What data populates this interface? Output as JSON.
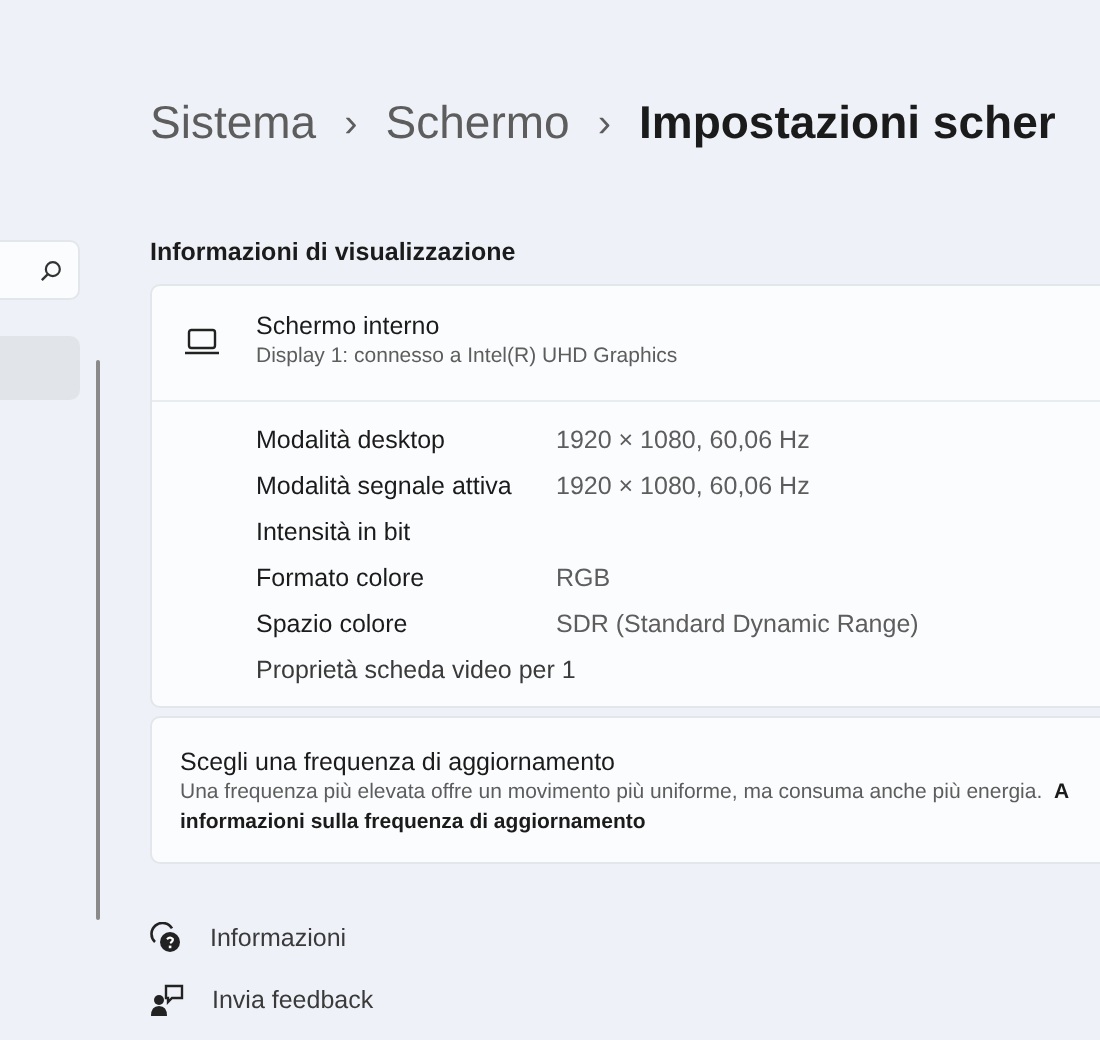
{
  "breadcrumb": [
    {
      "label": "Sistema",
      "current": false
    },
    {
      "label": "Schermo",
      "current": false
    },
    {
      "label": "Impostazioni scher",
      "current": true
    }
  ],
  "separators": [
    "›",
    "›"
  ],
  "sidebar": {
    "items": [
      {
        "selected": true
      }
    ]
  },
  "section_title": "Informazioni di visualizzazione",
  "display": {
    "title": "Schermo interno",
    "subtitle": "Display 1: connesso a Intel(R) UHD Graphics"
  },
  "details": [
    {
      "label": "Modalità desktop",
      "value": "1920 × 1080, 60,06 Hz"
    },
    {
      "label": "Modalità segnale attiva",
      "value": "1920 × 1080, 60,06 Hz"
    },
    {
      "label": "Intensità in bit"
    },
    {
      "label": "Formato colore",
      "value": "RGB"
    },
    {
      "label": "Spazio colore",
      "value": "SDR (Standard Dynamic Range)"
    }
  ],
  "adapter_link": "Proprietà scheda video per 1",
  "refresh": {
    "title": "Scegli una frequenza di aggiornamento",
    "description": "Una frequenza più elevata offre un movimento più uniforme, ma consuma anche più energia.",
    "link_lines": [
      "A",
      "informazioni sulla frequenza di aggiornamento"
    ]
  },
  "footer_links": [
    {
      "kind": "help",
      "label": "Informazioni"
    },
    {
      "kind": "feedback",
      "label": "Invia feedback"
    }
  ]
}
